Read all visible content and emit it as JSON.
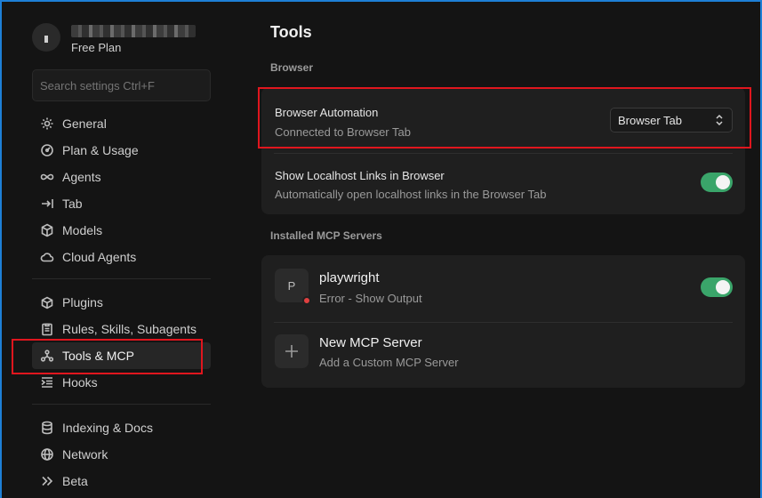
{
  "profile": {
    "plan": "Free Plan"
  },
  "search": {
    "placeholder": "Search settings Ctrl+F"
  },
  "sidebar": {
    "group1": [
      {
        "label": "General",
        "icon": "gear-icon"
      },
      {
        "label": "Plan & Usage",
        "icon": "gauge-icon"
      },
      {
        "label": "Agents",
        "icon": "infinity-icon"
      },
      {
        "label": "Tab",
        "icon": "tab-arrow-icon"
      },
      {
        "label": "Models",
        "icon": "cube-icon"
      },
      {
        "label": "Cloud Agents",
        "icon": "cloud-icon"
      }
    ],
    "group2": [
      {
        "label": "Plugins",
        "icon": "plugin-icon"
      },
      {
        "label": "Rules, Skills, Subagents",
        "icon": "clipboard-icon"
      },
      {
        "label": "Tools & MCP",
        "icon": "nodes-icon",
        "active": true
      },
      {
        "label": "Hooks",
        "icon": "hooks-icon"
      }
    ],
    "group3": [
      {
        "label": "Indexing & Docs",
        "icon": "database-icon"
      },
      {
        "label": "Network",
        "icon": "globe-icon"
      },
      {
        "label": "Beta",
        "icon": "double-chevron-icon"
      }
    ]
  },
  "main": {
    "title": "Tools",
    "browser_section": "Browser",
    "browser_automation": {
      "title": "Browser Automation",
      "subtitle": "Connected to Browser Tab",
      "select_value": "Browser Tab"
    },
    "localhost_links": {
      "title": "Show Localhost Links in Browser",
      "subtitle": "Automatically open localhost links in the Browser Tab",
      "enabled": true
    },
    "mcp_section": "Installed MCP Servers",
    "servers": [
      {
        "initial": "P",
        "name": "playwright",
        "status": "Error - Show Output",
        "enabled": true
      }
    ],
    "new_server": {
      "title": "New MCP Server",
      "subtitle": "Add a Custom MCP Server"
    }
  },
  "colors": {
    "accent_toggle": "#3aa56a",
    "error_dot": "#e04040",
    "highlight_box": "#e0161e",
    "window_border": "#1e7fd6"
  }
}
